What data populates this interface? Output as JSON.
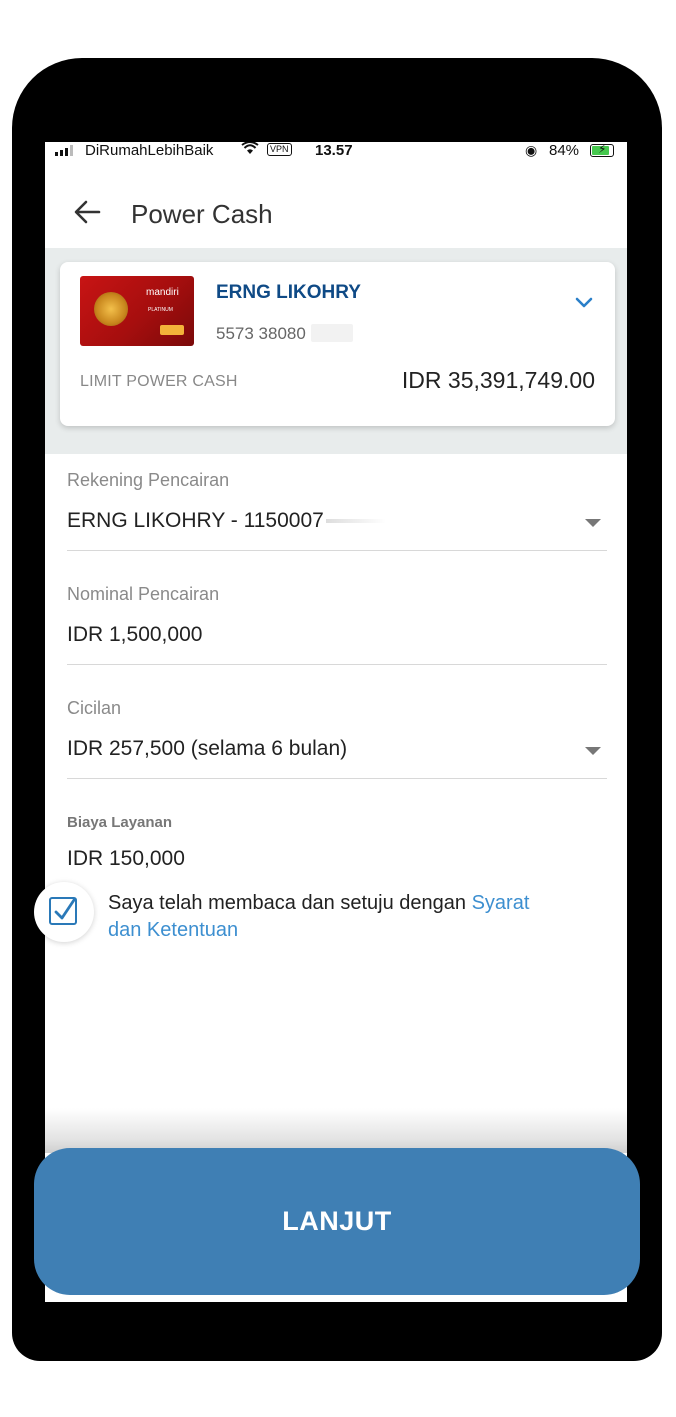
{
  "status_bar": {
    "carrier": "DiRumahLebihBaik",
    "vpn": "VPN",
    "time": "13.57",
    "battery": "84%",
    "battery_level": 0.84
  },
  "header": {
    "title": "Power Cash"
  },
  "card": {
    "bank_brand": "mandiri",
    "card_tier": "PLATINUM",
    "holder_name": "ERNG LIKOHRY",
    "card_number": "5573 38080",
    "limit_label": "LIMIT POWER CASH",
    "limit_value": "IDR 35,391,749.00"
  },
  "form": {
    "account": {
      "label": "Rekening Pencairan",
      "value": "ERNG LIKOHRY - 1150007"
    },
    "amount": {
      "label": "Nominal Pencairan",
      "value": "IDR 1,500,000"
    },
    "installment": {
      "label": "Cicilan",
      "value": "IDR 257,500 (selama 6 bulan)"
    },
    "fee": {
      "label": "Biaya Layanan",
      "value": "IDR 150,000"
    }
  },
  "agreement": {
    "checked": true,
    "text": "Saya telah membaca dan setuju dengan ",
    "link": "Syarat dan Ketentuan"
  },
  "submit": {
    "label": "LANJUT"
  },
  "colors": {
    "accent": "#3f7fb4",
    "link": "#3d8fd0",
    "holder": "#0f4a86"
  }
}
